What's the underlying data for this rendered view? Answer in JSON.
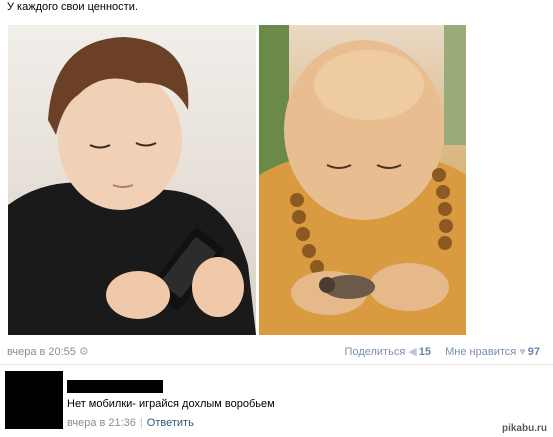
{
  "post": {
    "text": "У каждого свои ценности.",
    "time": "вчера в 20:55",
    "share_label": "Поделиться",
    "share_count": "15",
    "like_label": "Мне нравится",
    "like_count": "97"
  },
  "comment": {
    "text": "Нет мобилки- играйся дохлым воробьем",
    "time": "вчера в 21:36",
    "separator": "|",
    "reply_label": "Ответить"
  },
  "watermark": {
    "pre": "pikabu",
    "dot": ".",
    "post": "ru"
  },
  "icons": {
    "gear": "gear-icon",
    "share": "megaphone-icon",
    "like": "heart-icon"
  },
  "colors": {
    "link_blue": "#2b587a",
    "muted_gray": "#8c8c8c",
    "count_blue": "#6d86a8"
  }
}
